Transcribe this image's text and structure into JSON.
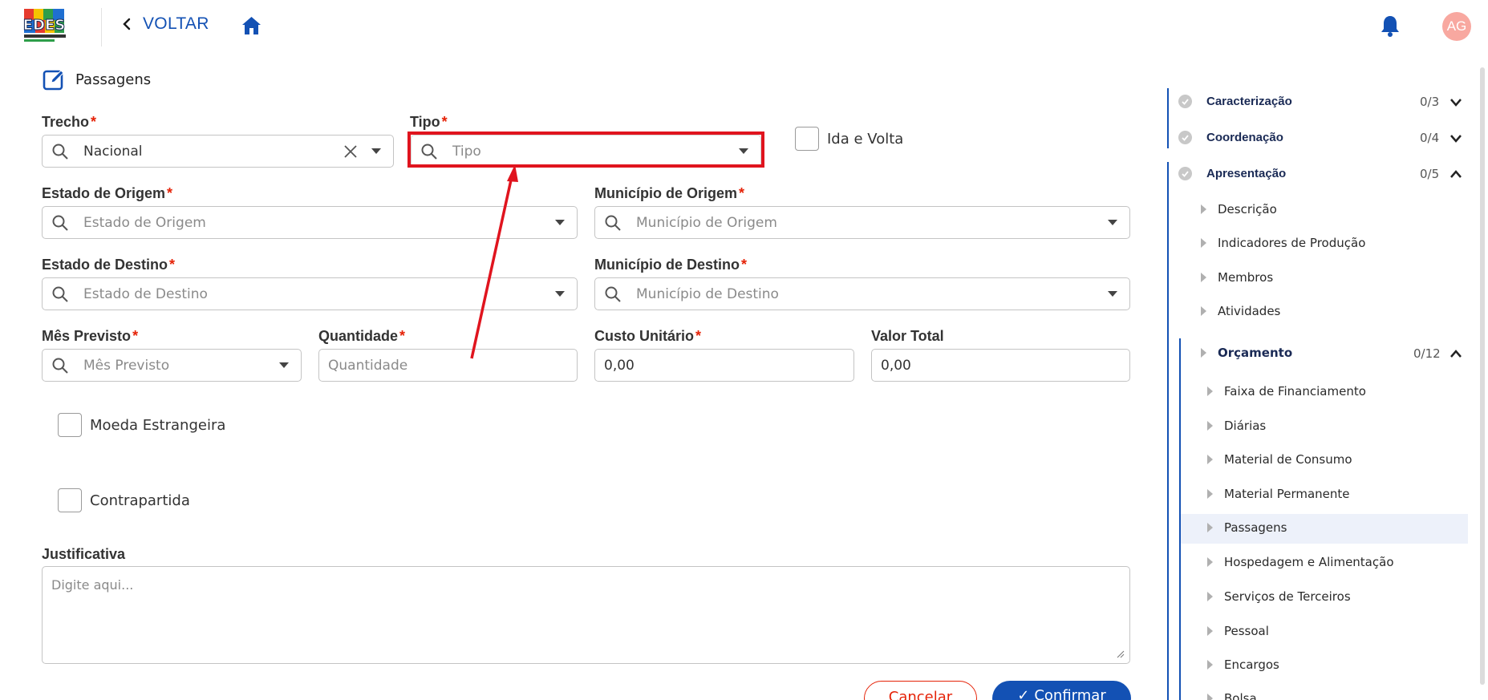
{
  "header": {
    "logo_text": "EDES",
    "back_label": "VOLTAR",
    "avatar_initials": "AG"
  },
  "section": {
    "title": "Passagens"
  },
  "form": {
    "trecho": {
      "label": "Trecho",
      "value": "Nacional"
    },
    "tipo": {
      "label": "Tipo",
      "placeholder": "Tipo"
    },
    "ida_volta": {
      "label": "Ida e Volta"
    },
    "estado_origem": {
      "label": "Estado de Origem",
      "placeholder": "Estado de Origem"
    },
    "municipio_origem": {
      "label": "Município de Origem",
      "placeholder": "Município de Origem"
    },
    "estado_destino": {
      "label": "Estado de Destino",
      "placeholder": "Estado de Destino"
    },
    "municipio_destino": {
      "label": "Município de Destino",
      "placeholder": "Município de Destino"
    },
    "mes_previsto": {
      "label": "Mês Previsto",
      "placeholder": "Mês Previsto"
    },
    "quantidade": {
      "label": "Quantidade",
      "placeholder": "Quantidade"
    },
    "custo_unitario": {
      "label": "Custo Unitário",
      "value": "0,00"
    },
    "valor_total": {
      "label": "Valor Total",
      "value": "0,00"
    },
    "moeda_estrangeira": {
      "label": "Moeda Estrangeira"
    },
    "contrapartida": {
      "label": "Contrapartida"
    },
    "justificativa": {
      "label": "Justificativa",
      "placeholder": "Digite aqui..."
    },
    "required_mark": "*",
    "cancel_label": "Cancelar",
    "confirm_label": "Confirmar"
  },
  "nav": {
    "caracterizacao": {
      "label": "Caracterização",
      "count": "0/3"
    },
    "coordenacao": {
      "label": "Coordenação",
      "count": "0/4"
    },
    "apresentacao": {
      "label": "Apresentação",
      "count": "0/5"
    },
    "sub": [
      "Descrição",
      "Indicadores de Produção",
      "Membros",
      "Atividades"
    ],
    "orcamento": {
      "label": "Orçamento",
      "count": "0/12"
    },
    "orcamento_items": [
      "Faixa de Financiamento",
      "Diárias",
      "Material de Consumo",
      "Material Permanente",
      "Passagens",
      "Hospedagem e Alimentação",
      "Serviços de Terceiros",
      "Pessoal",
      "Encargos",
      "Bolsa"
    ]
  },
  "colors": {
    "primary": "#1351b4",
    "required": "#e52207",
    "highlight": "#e0141e"
  }
}
